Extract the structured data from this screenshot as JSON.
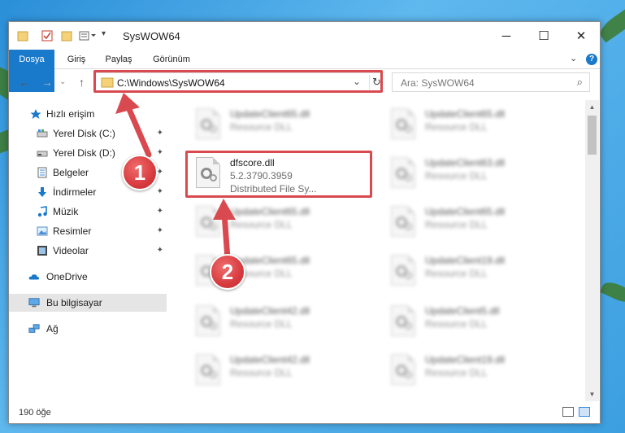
{
  "window": {
    "title": "SysWOW64",
    "minimize_glyph": "─",
    "maximize_glyph": "☐",
    "close_glyph": "✕"
  },
  "ribbon": {
    "tabs": [
      "Dosya",
      "Giriş",
      "Paylaş",
      "Görünüm"
    ],
    "expand_glyph": "⌄",
    "help_glyph": "?"
  },
  "navigation": {
    "back_glyph": "←",
    "forward_glyph": "→",
    "up_glyph": "↑",
    "address": "C:\\Windows\\SysWOW64",
    "address_dropdown_glyph": "⌄",
    "refresh_glyph": "↻",
    "search_placeholder": "Ara: SysWOW64",
    "search_glyph": "⌕"
  },
  "sidebar": {
    "items": [
      {
        "label": "Hızlı erişim",
        "icon": "star-icon"
      },
      {
        "label": "Yerel Disk (C:)",
        "icon": "drive-icon"
      },
      {
        "label": "Yerel Disk (D:)",
        "icon": "drive-icon"
      },
      {
        "label": "Belgeler",
        "icon": "documents-icon"
      },
      {
        "label": "İndirmeler",
        "icon": "download-icon"
      },
      {
        "label": "Müzik",
        "icon": "music-icon"
      },
      {
        "label": "Resimler",
        "icon": "pictures-icon"
      },
      {
        "label": "Videolar",
        "icon": "videos-icon"
      },
      {
        "label": "OneDrive",
        "icon": "cloud-icon"
      },
      {
        "label": "Bu bilgisayar",
        "icon": "computer-icon"
      },
      {
        "label": "Ağ",
        "icon": "network-icon"
      }
    ],
    "pin_glyph": "📌"
  },
  "files": {
    "left": [
      {
        "name": "UpdateClient65.dll",
        "sub1": "Resource DLL",
        "sub2": ""
      },
      {
        "name": "dfscore.dll",
        "sub1": "5.2.3790.3959",
        "sub2": "Distributed File Sy..."
      },
      {
        "name": "UpdateClient65.dll",
        "sub1": "Resource DLL",
        "sub2": ""
      },
      {
        "name": "UpdateClient65.dll",
        "sub1": "Resource DLL",
        "sub2": ""
      },
      {
        "name": "UpdateClient42.dll",
        "sub1": "Resource DLL",
        "sub2": ""
      },
      {
        "name": "UpdateClient42.dll",
        "sub1": "Resource DLL",
        "sub2": ""
      }
    ],
    "right": [
      {
        "name": "UpdateClient65.dll",
        "sub1": "Resource DLL"
      },
      {
        "name": "UpdateClient63.dll",
        "sub1": "Resource DLL"
      },
      {
        "name": "UpdateClient65.dll",
        "sub1": "Resource DLL"
      },
      {
        "name": "UpdateClient19.dll",
        "sub1": "Resource DLL"
      },
      {
        "name": "UpdateClient5.dll",
        "sub1": "Resource DLL"
      },
      {
        "name": "UpdateClient19.dll",
        "sub1": "Resource DLL"
      }
    ]
  },
  "status": {
    "item_count": "190 öğe"
  },
  "annotations": {
    "step1": "1",
    "step2": "2",
    "color": "#d84a4f"
  },
  "colors": {
    "file_tab": "#1979ca",
    "highlight": "#d84a4f",
    "selected_nav": "#e5e5e5"
  }
}
